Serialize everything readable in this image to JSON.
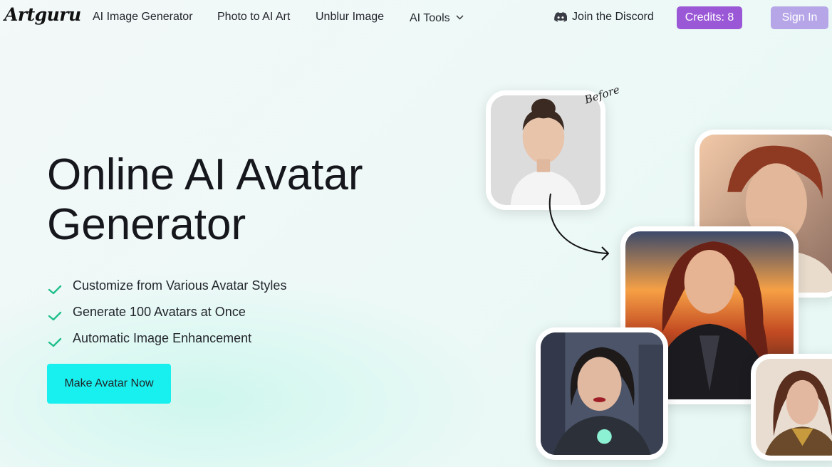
{
  "brand": {
    "logo_text": "Artguru"
  },
  "nav": {
    "links": [
      "AI Image Generator",
      "Photo to AI Art",
      "Unblur Image",
      "AI Tools"
    ],
    "discord_label": "Join the Discord",
    "credits_label": "Credits: 8",
    "signin_label": "Sign In"
  },
  "hero": {
    "title_line1": "Online AI Avatar",
    "title_line2": "Generator",
    "features": [
      "Customize from Various Avatar Styles",
      "Generate 100 Avatars at Once",
      "Automatic Image Enhancement"
    ],
    "cta_label": "Make Avatar Now"
  },
  "showcase": {
    "before_label": "Before"
  },
  "colors": {
    "credits_bg": "#9b58d6",
    "signin_bg": "#b6a6e8",
    "cta_bg": "#18f0ef",
    "check": "#1fc08a"
  },
  "icons": [
    "discord-icon",
    "chevron-down-icon",
    "check-icon",
    "curved-arrow-icon"
  ]
}
